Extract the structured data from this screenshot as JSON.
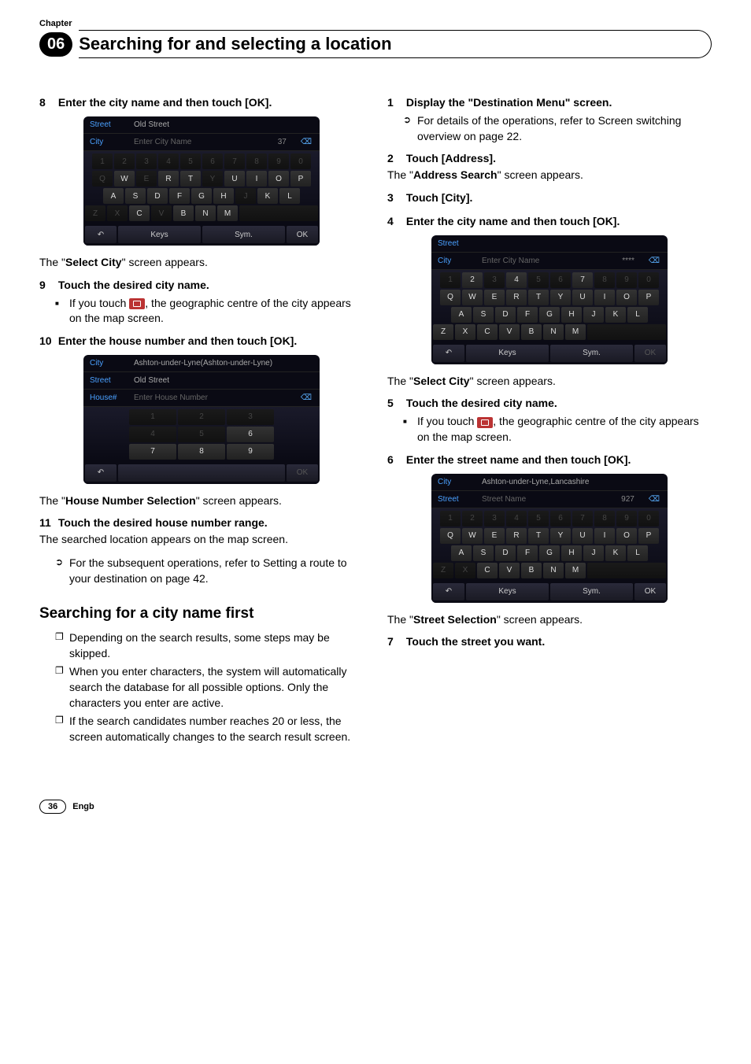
{
  "header": {
    "chapter_label": "Chapter",
    "chapter_number": "06",
    "title": "Searching for and selecting a location"
  },
  "left": {
    "step8": {
      "num": "8",
      "text": "Enter the city name and then touch [OK]."
    },
    "ss1": {
      "r1_label": "Street",
      "r1_value": "Old Street",
      "r2_label": "City",
      "r2_value": "Enter City Name",
      "r2_tag": "37",
      "kr1": [
        "1",
        "2",
        "3",
        "4",
        "5",
        "6",
        "7",
        "8",
        "9",
        "0"
      ],
      "kr2": [
        "Q",
        "W",
        "E",
        "R",
        "T",
        "Y",
        "U",
        "I",
        "O",
        "P"
      ],
      "kr3": [
        "A",
        "S",
        "D",
        "F",
        "G",
        "H",
        "J",
        "K",
        "L"
      ],
      "kr4": [
        "Z",
        "X",
        "C",
        "V",
        "B",
        "N",
        "M"
      ],
      "bottom": {
        "back": "↶",
        "b1": "Keys",
        "b2": "Sym.",
        "ok": "OK"
      }
    },
    "after_ss1_pre": "The \"",
    "after_ss1_bold": "Select City",
    "after_ss1_post": "\" screen appears.",
    "step9": {
      "num": "9",
      "text": "Touch the desired city name."
    },
    "step9_bullet": ", the geographic centre of the city appears on the map screen.",
    "step9_bullet_prefix": "If you touch ",
    "step10": {
      "num": "10",
      "text": "Enter the house number and then touch [OK]."
    },
    "ss2": {
      "r1_label": "City",
      "r1_value": "Ashton-under-Lyne(Ashton-under-Lyne)",
      "r2_label": "Street",
      "r2_value": "Old Street",
      "r3_label": "House#",
      "r3_value": "Enter House Number",
      "kr1": [
        "1",
        "2",
        "3"
      ],
      "kr2": [
        "4",
        "5",
        "6"
      ],
      "kr3": [
        "7",
        "8",
        "9"
      ],
      "bottom": {
        "back": "↶",
        "ok": "OK"
      }
    },
    "after_ss2_pre": "The \"",
    "after_ss2_bold": "House Number Selection",
    "after_ss2_post": "\" screen appears.",
    "step11": {
      "num": "11",
      "text": "Touch the desired house number range."
    },
    "step11_body": "The searched location appears on the map screen.",
    "step11_ref_prefix": "For the subsequent operations, refer to ",
    "step11_ref_italic": "Setting a route to your destination",
    "step11_ref_suffix": " on page 42.",
    "subheading": "Searching for a city name first",
    "notes": [
      "Depending on the search results, some steps may be skipped.",
      "When you enter characters, the system will automatically search the database for all possible options. Only the characters you enter are active.",
      "If the search candidates number reaches 20 or less, the screen automatically changes to the search result screen."
    ]
  },
  "right": {
    "step1": {
      "num": "1",
      "text": "Display the \"Destination Menu\" screen."
    },
    "step1_ref_prefix": "For details of the operations, refer to ",
    "step1_ref_italic": "Screen switching overview",
    "step1_ref_suffix": " on page 22.",
    "step2": {
      "num": "2",
      "text": "Touch [Address]."
    },
    "step2_body_pre": "The \"",
    "step2_body_bold": "Address Search",
    "step2_body_post": "\" screen appears.",
    "step3": {
      "num": "3",
      "text": "Touch [City]."
    },
    "step4": {
      "num": "4",
      "text": "Enter the city name and then touch [OK]."
    },
    "ss3": {
      "r1_label": "Street",
      "r1_value": "",
      "r2_label": "City",
      "r2_value": "Enter City Name",
      "r2_tag": "****",
      "kr1": [
        "1",
        "2",
        "3",
        "4",
        "5",
        "6",
        "7",
        "8",
        "9",
        "0"
      ],
      "kr2": [
        "Q",
        "W",
        "E",
        "R",
        "T",
        "Y",
        "U",
        "I",
        "O",
        "P"
      ],
      "kr3": [
        "A",
        "S",
        "D",
        "F",
        "G",
        "H",
        "J",
        "K",
        "L"
      ],
      "kr4": [
        "Z",
        "X",
        "C",
        "V",
        "B",
        "N",
        "M"
      ],
      "bottom": {
        "back": "↶",
        "b1": "Keys",
        "b2": "Sym.",
        "ok": "OK"
      }
    },
    "after_ss3_pre": "The \"",
    "after_ss3_bold": "Select City",
    "after_ss3_post": "\" screen appears.",
    "step5": {
      "num": "5",
      "text": "Touch the desired city name."
    },
    "step5_bullet_prefix": "If you touch ",
    "step5_bullet": ", the geographic centre of the city appears on the map screen.",
    "step6": {
      "num": "6",
      "text": "Enter the street name and then touch [OK]."
    },
    "ss4": {
      "r1_label": "City",
      "r1_value": "Ashton-under-Lyne,Lancashire",
      "r2_label": "Street",
      "r2_value": "Street Name",
      "r2_tag": "927",
      "kr1": [
        "1",
        "2",
        "3",
        "4",
        "5",
        "6",
        "7",
        "8",
        "9",
        "0"
      ],
      "kr2": [
        "Q",
        "W",
        "E",
        "R",
        "T",
        "Y",
        "U",
        "I",
        "O",
        "P"
      ],
      "kr3": [
        "A",
        "S",
        "D",
        "F",
        "G",
        "H",
        "J",
        "K",
        "L"
      ],
      "kr4": [
        "Z",
        "X",
        "C",
        "V",
        "B",
        "N",
        "M"
      ],
      "bottom": {
        "back": "↶",
        "b1": "Keys",
        "b2": "Sym.",
        "ok": "OK"
      }
    },
    "after_ss4_pre": "The \"",
    "after_ss4_bold": "Street Selection",
    "after_ss4_post": "\" screen appears.",
    "step7": {
      "num": "7",
      "text": "Touch the street you want."
    }
  },
  "footer": {
    "page": "36",
    "lang": "Engb"
  }
}
